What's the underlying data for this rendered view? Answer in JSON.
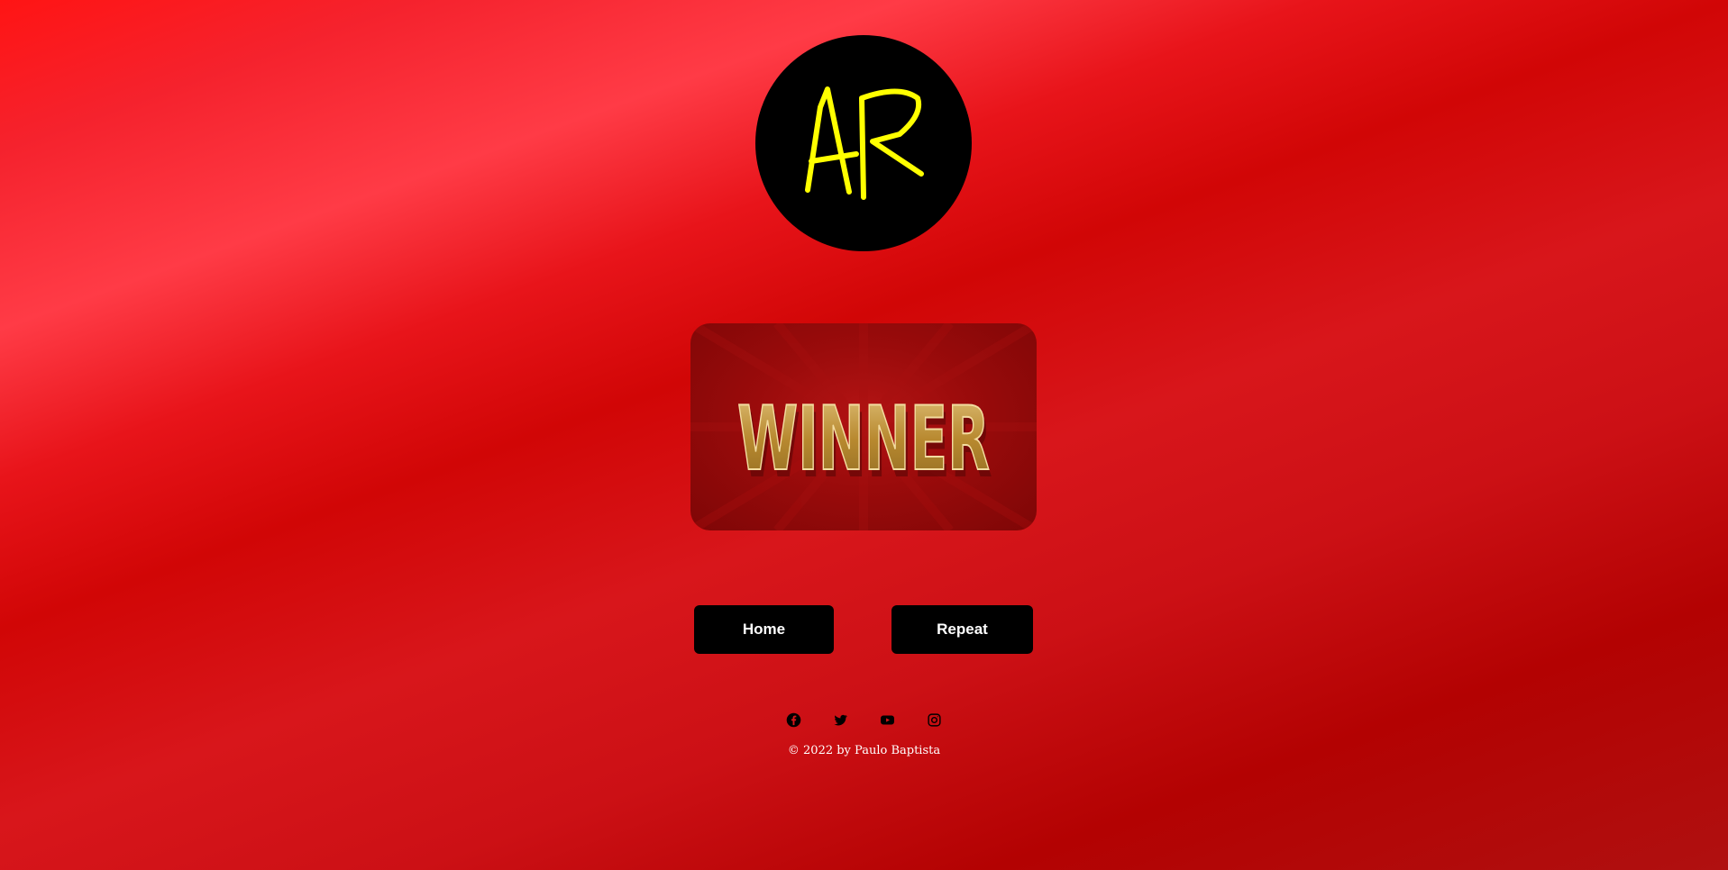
{
  "logo": {
    "text": "AR",
    "icon": "ar-monogram-logo",
    "background": "#000000",
    "letter_color": "#ffff00"
  },
  "winner_banner": {
    "text": "WINNER",
    "icon": "winner-banner-image",
    "text_color": "#c9a24a",
    "background": "#9a0b0b"
  },
  "buttons": {
    "home_label": "Home",
    "repeat_label": "Repeat"
  },
  "social": [
    {
      "name": "facebook",
      "icon": "facebook-icon"
    },
    {
      "name": "twitter",
      "icon": "twitter-icon"
    },
    {
      "name": "youtube",
      "icon": "youtube-icon"
    },
    {
      "name": "instagram",
      "icon": "instagram-icon"
    }
  ],
  "footer": {
    "copyright": "© 2022 by Paulo Baptista"
  },
  "colors": {
    "accent": "#e8141a",
    "button_bg": "#000000",
    "button_text": "#ffffff"
  }
}
